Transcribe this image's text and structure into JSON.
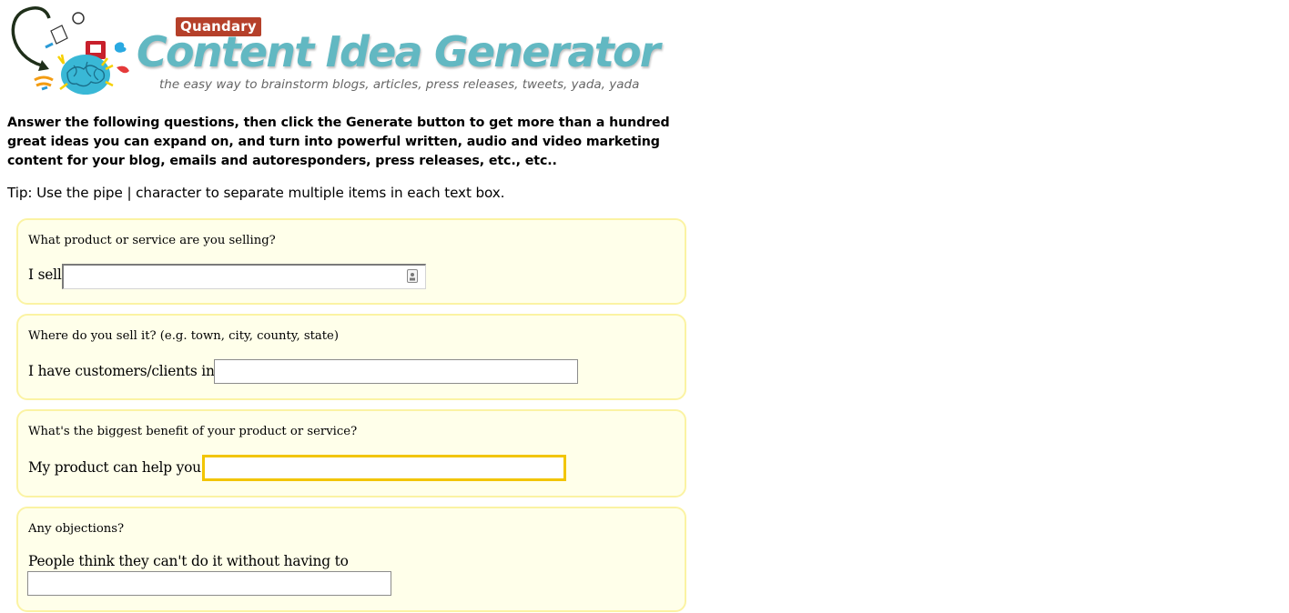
{
  "header": {
    "brand_badge": "Quandary",
    "title": "Content Idea Generator",
    "tagline": "the easy way to brainstorm blogs, articles, press releases, tweets, yada, yada",
    "logo_icon": "brainstorm-collage-icon",
    "colors": {
      "title": "#62b8c2",
      "badge": "#b5402a",
      "tagline": "#666666"
    }
  },
  "intro": "Answer the following questions, then click the Generate button to get more than a hundred great ideas you can expand on, and turn into powerful written, audio and video marketing content for your blog, emails and autoresponders, press releases, etc., etc..",
  "tip": "Tip: Use the pipe | character to separate multiple items in each text box.",
  "questions": [
    {
      "question": "What product or service are you selling?",
      "label": "I sell",
      "value": "",
      "placeholder": "",
      "icon": "contact-autofill-icon"
    },
    {
      "question": "Where do you sell it? (e.g. town, city, county, state)",
      "label": "I have customers/clients in",
      "value": "",
      "placeholder": ""
    },
    {
      "question": "What's the biggest benefit of your product or service?",
      "label": "My product can help you",
      "value": "",
      "placeholder": "",
      "state": "focused"
    },
    {
      "question": "Any objections?",
      "label": "People think they can't do it without having to",
      "value": "",
      "placeholder": ""
    }
  ],
  "colors": {
    "box_background": "#ffffea",
    "box_border": "#fbf3a3",
    "focus_border": "#f2c500"
  }
}
